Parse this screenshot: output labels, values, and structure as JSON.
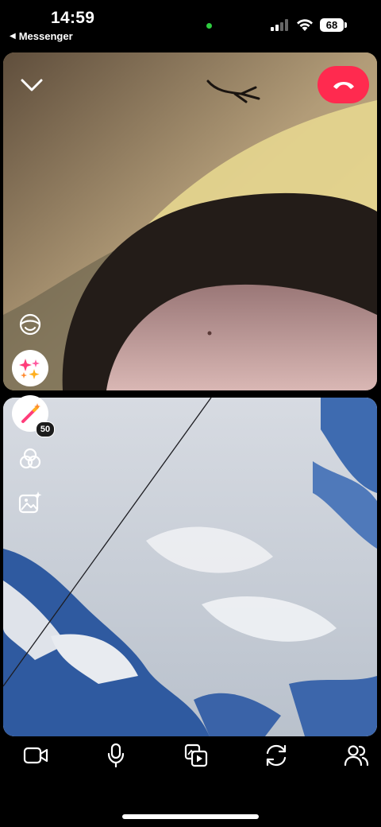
{
  "status_bar": {
    "time": "14:59",
    "back_label": "Messenger",
    "back_icon": "triangle-left",
    "battery": "68",
    "mic_indicator_color": "#2ecc40"
  },
  "call": {
    "end_call_color": "#ff2a4f",
    "effects_badge": "50"
  },
  "side_tools": [
    "avatar-icon",
    "sparkles-icon",
    "magic-wand-icon",
    "filters-icon",
    "background-icon"
  ],
  "controls": [
    "video-camera-icon",
    "microphone-icon",
    "share-media-icon",
    "switch-camera-icon",
    "participants-icon"
  ]
}
